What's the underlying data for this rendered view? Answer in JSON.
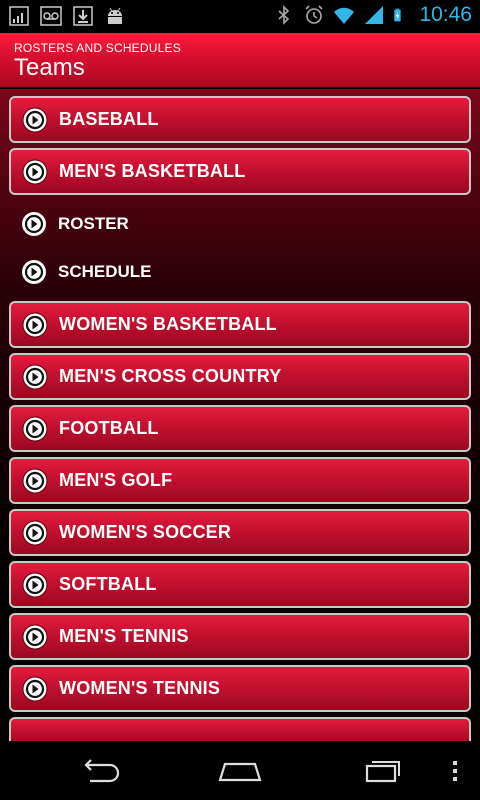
{
  "status_bar": {
    "time": "10:46",
    "left_icons": [
      "signal-bars-icon",
      "voicemail-icon",
      "download-icon",
      "android-icon"
    ],
    "right_icons": [
      "bluetooth-icon",
      "alarm-icon",
      "wifi-icon",
      "cell-signal-icon",
      "battery-charging-icon"
    ],
    "time_color": "#33b5e5"
  },
  "header": {
    "subtitle": "ROSTERS AND SCHEDULES",
    "title": "Teams",
    "accent_color": "#d70f2f"
  },
  "list": {
    "items": [
      {
        "label": "BASEBALL",
        "type": "team"
      },
      {
        "label": "MEN'S BASKETBALL",
        "type": "team",
        "expanded": true
      },
      {
        "label": "ROSTER",
        "type": "sub"
      },
      {
        "label": "SCHEDULE",
        "type": "sub"
      },
      {
        "label": "WOMEN'S BASKETBALL",
        "type": "team"
      },
      {
        "label": "MEN'S CROSS COUNTRY",
        "type": "team"
      },
      {
        "label": "FOOTBALL",
        "type": "team"
      },
      {
        "label": "MEN'S GOLF",
        "type": "team"
      },
      {
        "label": "WOMEN'S SOCCER",
        "type": "team"
      },
      {
        "label": "SOFTBALL",
        "type": "team"
      },
      {
        "label": "MEN'S TENNIS",
        "type": "team"
      },
      {
        "label": "WOMEN'S TENNIS",
        "type": "team"
      }
    ]
  },
  "nav_bar": {
    "buttons": [
      "back-icon",
      "home-icon",
      "recent-apps-icon",
      "overflow-menu-icon"
    ]
  }
}
